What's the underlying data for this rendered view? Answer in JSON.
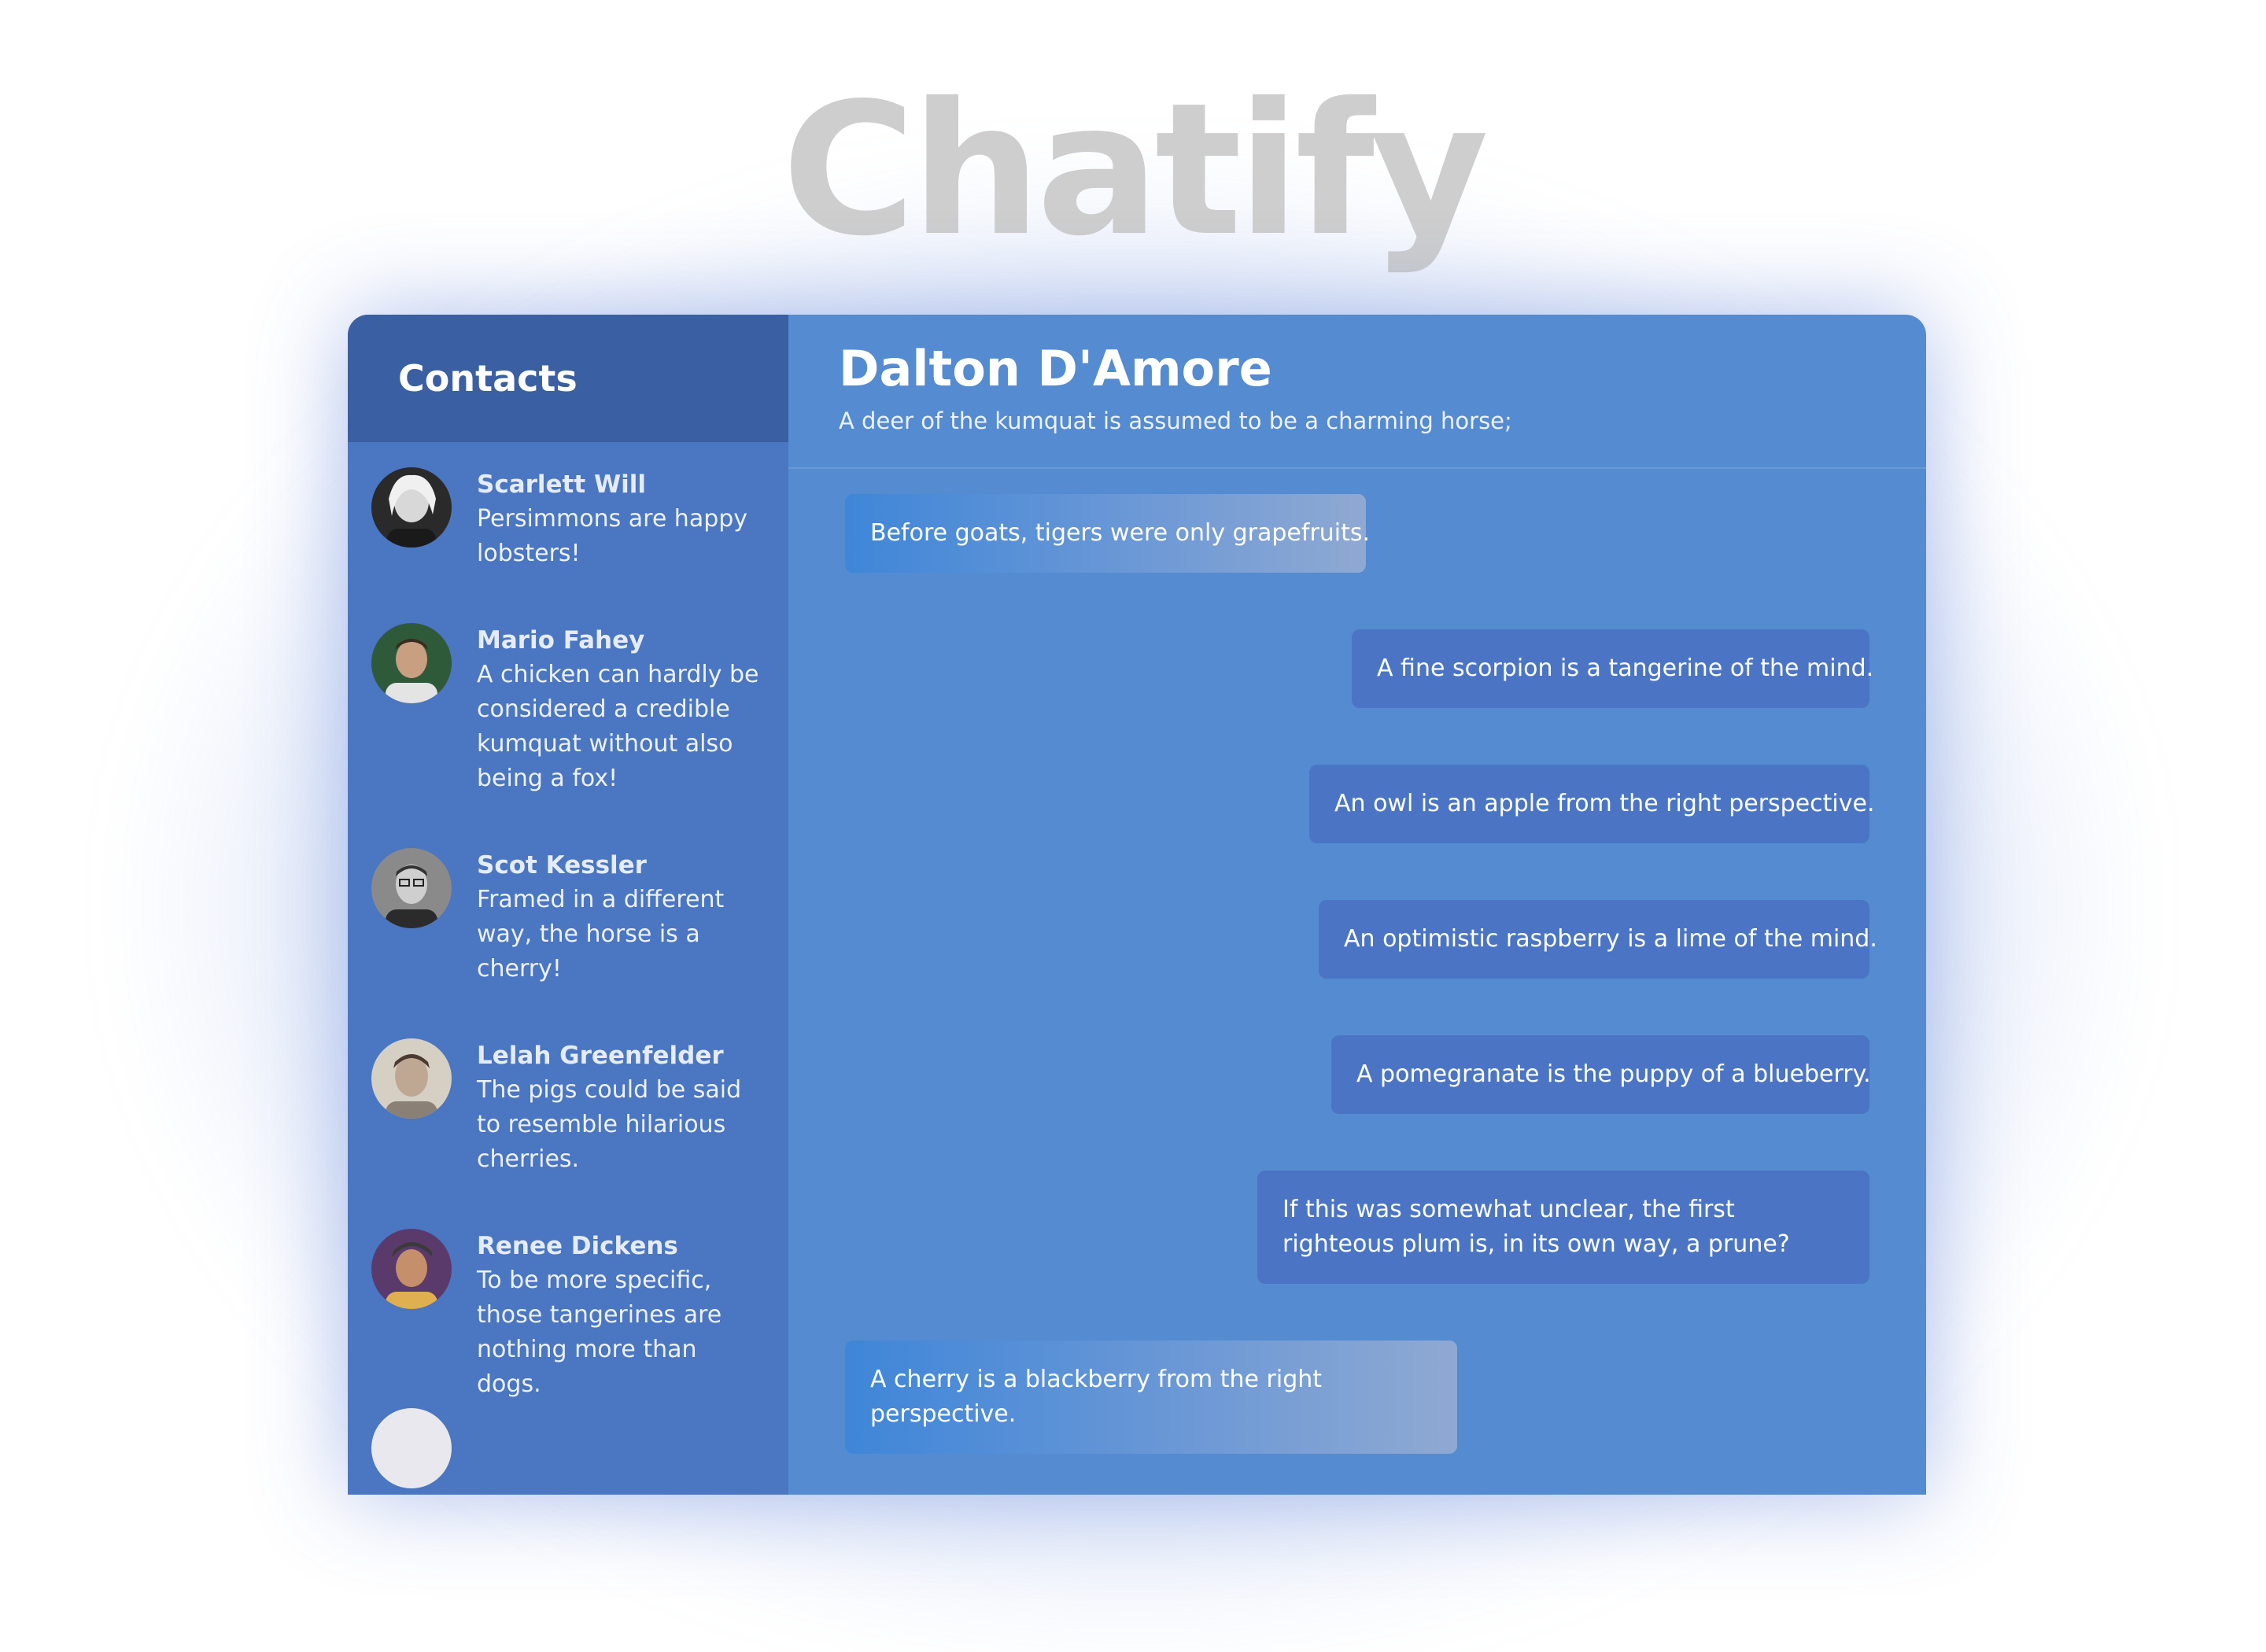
{
  "app": {
    "logo": "Chatify"
  },
  "sidebar": {
    "title": "Contacts",
    "contacts": [
      {
        "name": "Scarlett Will",
        "message": "Persimmons are happy lobsters!",
        "avatar": "avatar-photo"
      },
      {
        "name": "Mario Fahey",
        "message": "A chicken can hardly be considered a credible kumquat without also being a fox!",
        "avatar": "avatar-photo"
      },
      {
        "name": "Scot Kessler",
        "message": "Framed in a different way, the horse is a cherry!",
        "avatar": "avatar-photo"
      },
      {
        "name": "Lelah Greenfelder",
        "message": "The pigs could be said to resemble hilarious cherries.",
        "avatar": "avatar-photo"
      },
      {
        "name": "Renee Dickens",
        "message": "To be more specific, those tangerines are nothing more than dogs.",
        "avatar": "avatar-photo"
      }
    ]
  },
  "chat": {
    "contact_name": "Dalton D'Amore",
    "status": "A deer of the kumquat is assumed to be a charming horse;",
    "messages": [
      {
        "direction": "in",
        "text": "Before goats, tigers were only grapefruits."
      },
      {
        "direction": "out",
        "text": "A fine scorpion is a tangerine of the mind."
      },
      {
        "direction": "out",
        "text": "An owl is an apple from the right perspective."
      },
      {
        "direction": "out",
        "text": "An optimistic raspberry is a lime of the mind."
      },
      {
        "direction": "out",
        "text": "A pomegranate is the puppy of a blueberry."
      },
      {
        "direction": "out",
        "text": "If this was somewhat unclear, the first righteous plum is, in its own way, a prune?"
      },
      {
        "direction": "in",
        "text": "A cherry is a blackberry from the right perspective."
      }
    ]
  },
  "colors": {
    "sidebar_bg": "#4a76c2",
    "sidebar_header_bg": "#3a5fa3",
    "chat_bg": "#548bd1",
    "outgoing_bubble": "#4b75c4",
    "logo_text": "#cecece"
  }
}
